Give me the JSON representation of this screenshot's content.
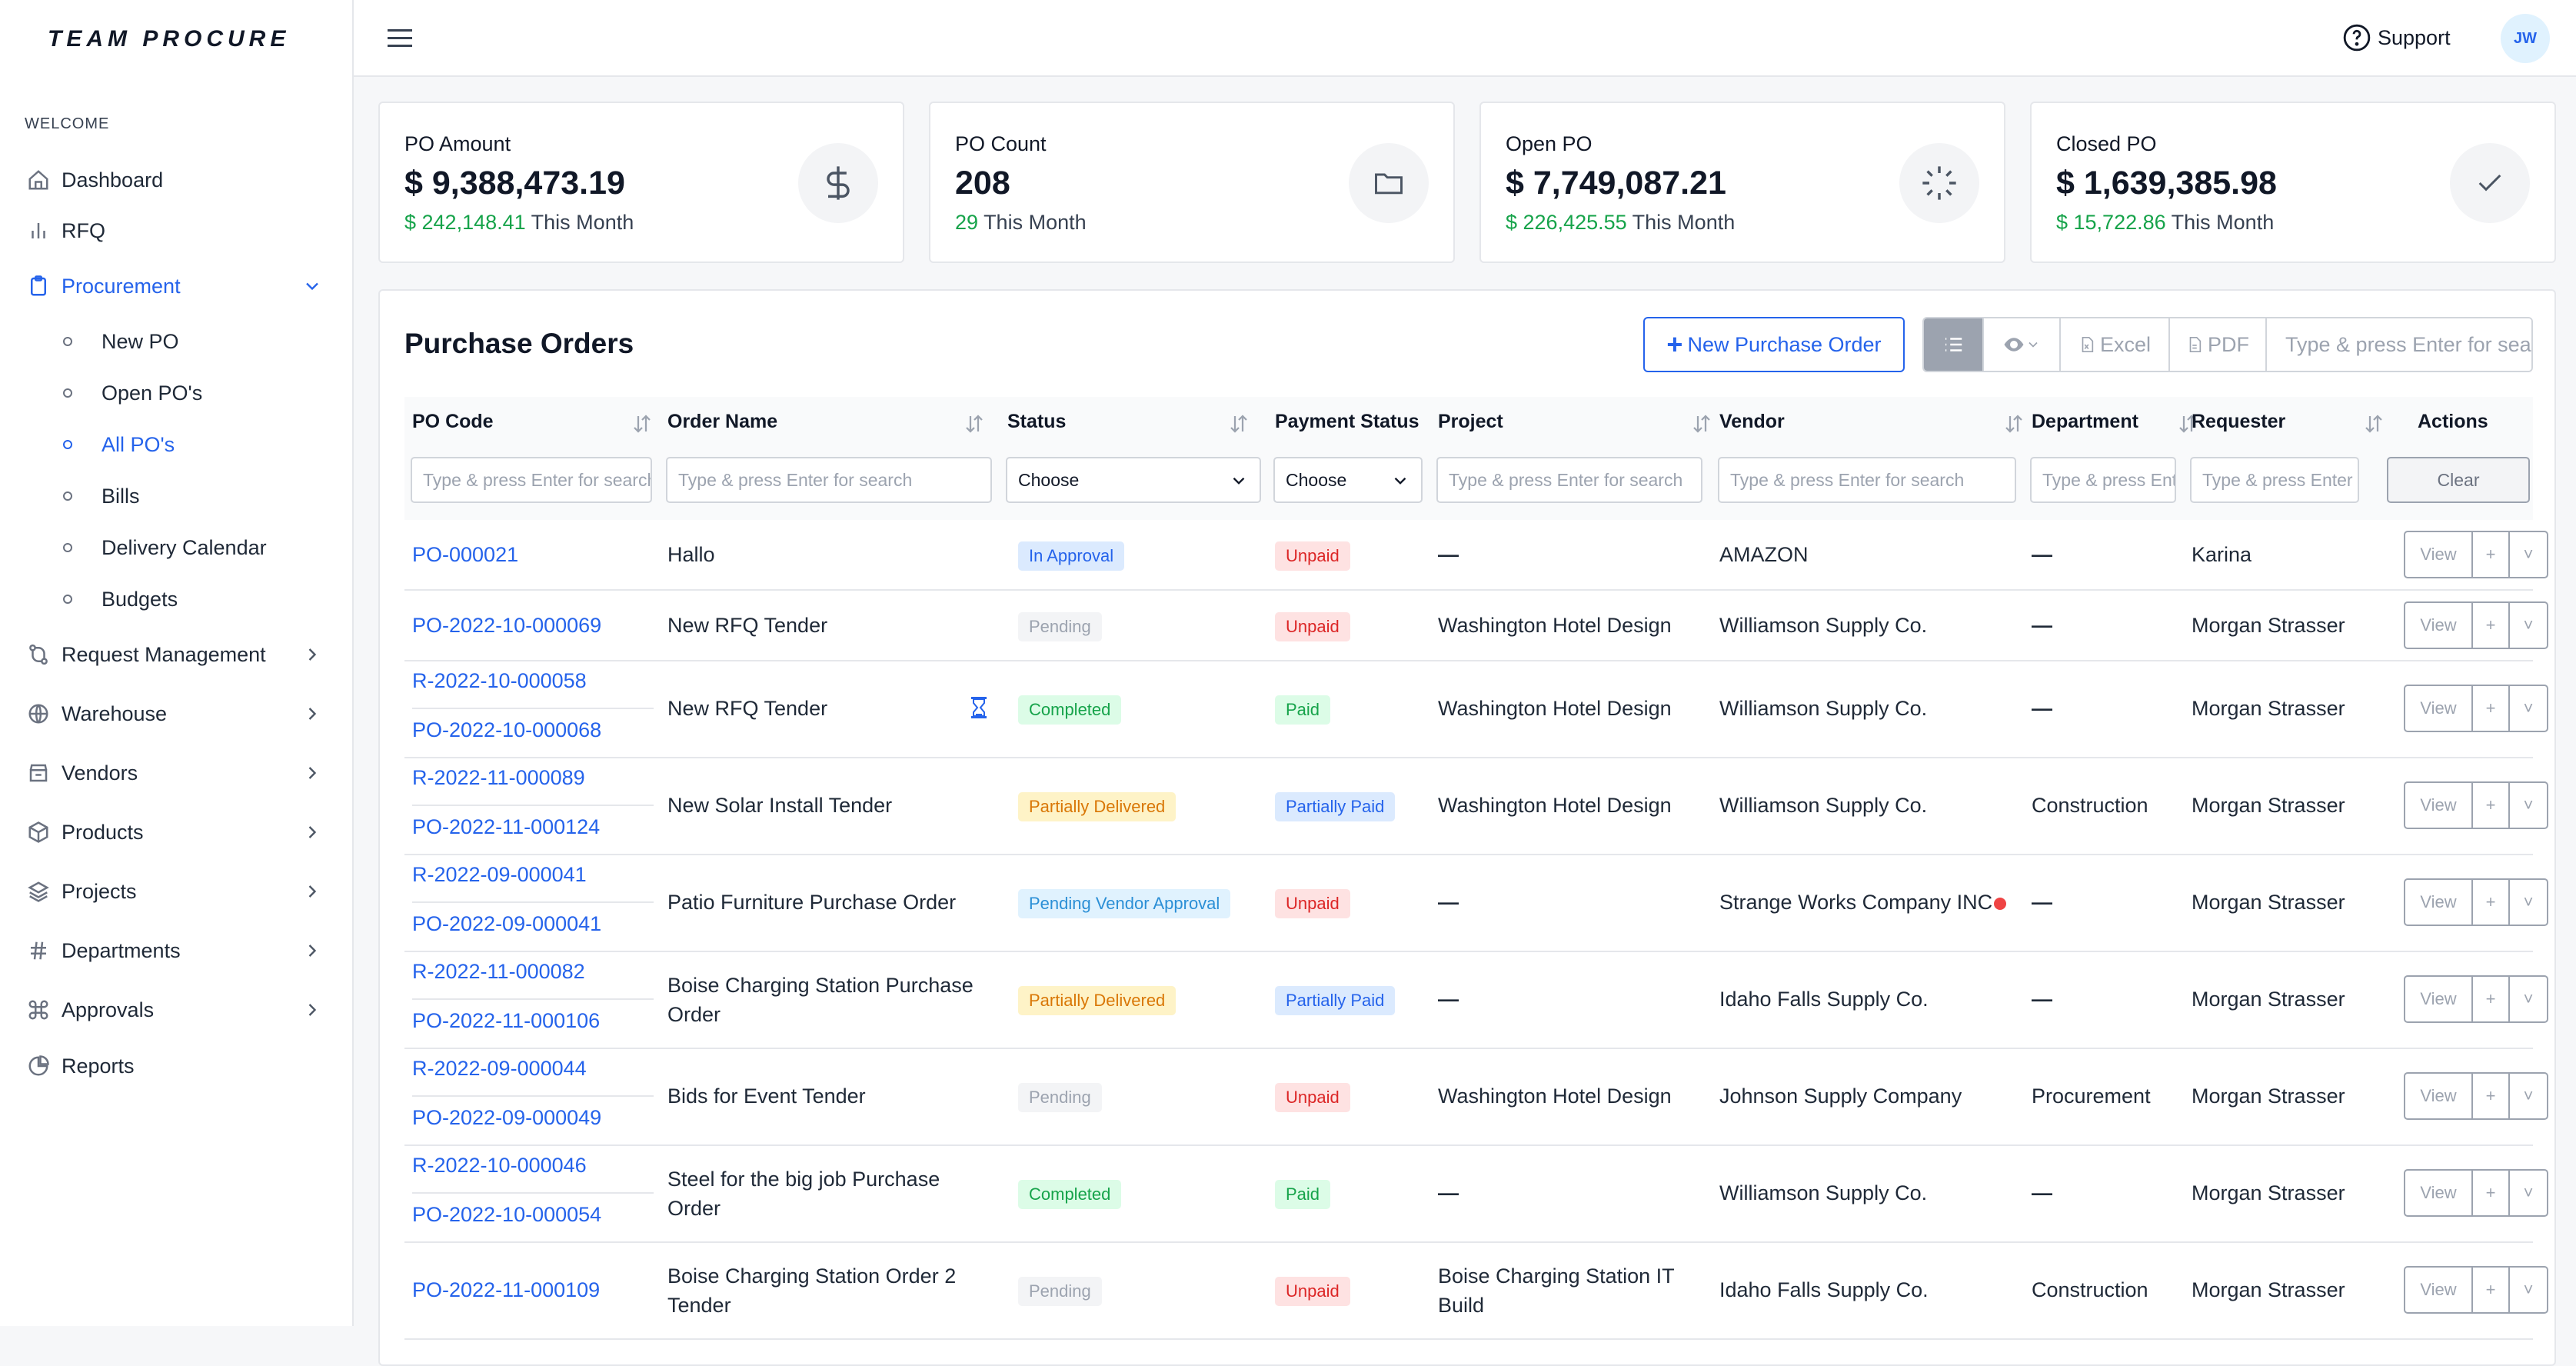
{
  "brand": "TEAM PROCURE",
  "sidebar": {
    "section_label": "WELCOME",
    "items": [
      {
        "label": "Dashboard",
        "icon": "home-icon"
      },
      {
        "label": "RFQ",
        "icon": "bar-chart-icon"
      },
      {
        "label": "Procurement",
        "icon": "clipboard-icon",
        "expanded": true
      },
      {
        "label": "Request Management",
        "icon": "git-branch-icon"
      },
      {
        "label": "Warehouse",
        "icon": "globe-icon"
      },
      {
        "label": "Vendors",
        "icon": "store-icon"
      },
      {
        "label": "Products",
        "icon": "box-icon"
      },
      {
        "label": "Projects",
        "icon": "layers-icon"
      },
      {
        "label": "Departments",
        "icon": "hash-icon"
      },
      {
        "label": "Approvals",
        "icon": "command-icon"
      },
      {
        "label": "Reports",
        "icon": "pie-chart-icon"
      }
    ],
    "procurement_sub": [
      "New PO",
      "Open PO's",
      "All PO's",
      "Bills",
      "Delivery Calendar",
      "Budgets"
    ]
  },
  "topbar": {
    "support": "Support",
    "avatar": "JW"
  },
  "cards": [
    {
      "label": "PO Amount",
      "value": "$ 9,388,473.19",
      "month_value": "$ 242,148.41",
      "month_text": "This Month",
      "icon": "dollar-icon"
    },
    {
      "label": "PO Count",
      "value": "208",
      "month_value": "29",
      "month_text": "This Month",
      "icon": "folder-icon"
    },
    {
      "label": "Open PO",
      "value": "$ 7,749,087.21",
      "month_value": "$ 226,425.55",
      "month_text": "This Month",
      "icon": "loader-icon"
    },
    {
      "label": "Closed PO",
      "value": "$ 1,639,385.98",
      "month_value": "$ 15,722.86",
      "month_text": "This Month",
      "icon": "check-icon"
    }
  ],
  "panel": {
    "title": "Purchase Orders",
    "new_button": "New Purchase Order",
    "excel": "Excel",
    "pdf": "PDF",
    "search_placeholder": "Type & press Enter for search"
  },
  "table": {
    "columns": [
      "PO Code",
      "Order Name",
      "Status",
      "Payment Status",
      "Project",
      "Vendor",
      "Department",
      "Requester",
      "Actions"
    ],
    "filter_placeholder": "Type & press Enter for search",
    "select_choose": "Choose",
    "clear": "Clear",
    "actions": {
      "view": "View",
      "plus": "+",
      "caret": "˅"
    },
    "rows": [
      {
        "codes": [
          "PO-000021"
        ],
        "order": [
          "Hallo"
        ],
        "status": "In Approval",
        "payment": "Unpaid",
        "project": [
          "—"
        ],
        "vendor": "AMAZON",
        "department": "—",
        "requester": "Karina"
      },
      {
        "codes": [
          "PO-2022-10-000069"
        ],
        "order": [
          "New RFQ Tender"
        ],
        "status": "Pending",
        "payment": "Unpaid",
        "project": [
          "Washington Hotel Design"
        ],
        "vendor": "Williamson Supply Co.",
        "department": "—",
        "requester": "Morgan Strasser"
      },
      {
        "codes": [
          "R-2022-10-000058",
          "PO-2022-10-000068"
        ],
        "order": [
          "New RFQ Tender"
        ],
        "status": "Completed",
        "payment": "Paid",
        "project": [
          "Washington Hotel Design"
        ],
        "vendor": "Williamson Supply Co.",
        "department": "—",
        "requester": "Morgan Strasser"
      },
      {
        "codes": [
          "R-2022-11-000089",
          "PO-2022-11-000124"
        ],
        "order": [
          "New Solar Install Tender"
        ],
        "status": "Partially Delivered",
        "payment": "Partially Paid",
        "project": [
          "Washington Hotel Design"
        ],
        "vendor": "Williamson Supply Co.",
        "department": "Construction",
        "requester": "Morgan Strasser"
      },
      {
        "codes": [
          "R-2022-09-000041",
          "PO-2022-09-000041"
        ],
        "order": [
          "Patio Furniture Purchase Order"
        ],
        "status": "Pending Vendor Approval",
        "payment": "Unpaid",
        "project": [
          "—"
        ],
        "vendor": "Strange Works Company INC",
        "department": "—",
        "requester": "Morgan Strasser"
      },
      {
        "codes": [
          "R-2022-11-000082",
          "PO-2022-11-000106"
        ],
        "order": [
          "Boise Charging Station Purchase",
          "Order"
        ],
        "status": "Partially Delivered",
        "payment": "Partially Paid",
        "project": [
          "—"
        ],
        "vendor": "Idaho Falls Supply Co.",
        "department": "—",
        "requester": "Morgan Strasser"
      },
      {
        "codes": [
          "R-2022-09-000044",
          "PO-2022-09-000049"
        ],
        "order": [
          "Bids for Event Tender"
        ],
        "status": "Pending",
        "payment": "Unpaid",
        "project": [
          "Washington Hotel Design"
        ],
        "vendor": "Johnson Supply Company",
        "department": "Procurement",
        "requester": "Morgan Strasser"
      },
      {
        "codes": [
          "R-2022-10-000046",
          "PO-2022-10-000054"
        ],
        "order": [
          "Steel for the big job Purchase",
          "Order"
        ],
        "status": "Completed",
        "payment": "Paid",
        "project": [
          "—"
        ],
        "vendor": "Williamson Supply Co.",
        "department": "—",
        "requester": "Morgan Strasser"
      },
      {
        "codes": [
          "PO-2022-11-000109"
        ],
        "order": [
          "Boise Charging Station Order 2",
          "Tender"
        ],
        "status": "Pending",
        "payment": "Unpaid",
        "project": [
          "Boise Charging Station IT",
          "Build"
        ],
        "vendor": "Idaho Falls Supply Co.",
        "department": "Construction",
        "requester": "Morgan Strasser"
      }
    ]
  }
}
